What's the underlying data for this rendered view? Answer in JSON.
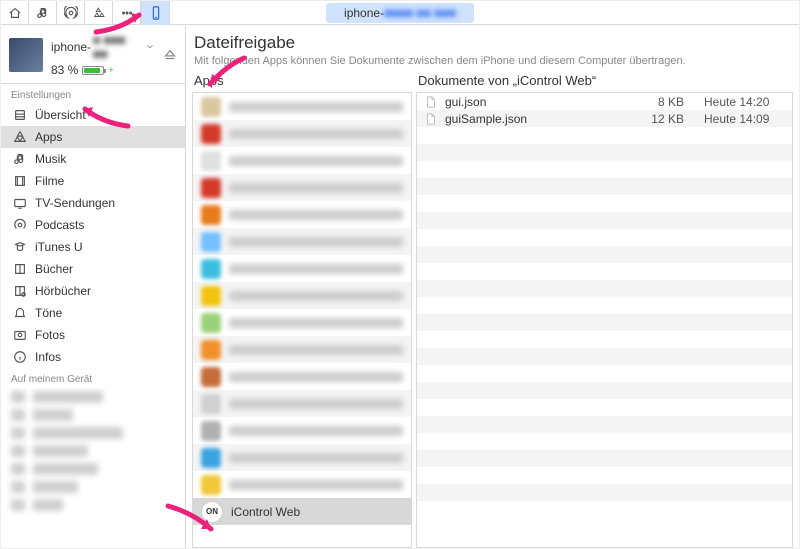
{
  "toolbar": {
    "title_prefix": "iphone-",
    "title_blur": "■■■■ ■■ ■■■"
  },
  "device": {
    "name_prefix": "iphone-",
    "name_blur": "■ ■■■ ■■",
    "battery_pct": "83 %"
  },
  "sidebar": {
    "section_settings": "Einstellungen",
    "section_on_device": "Auf meinem Gerät",
    "items": [
      {
        "label": "Übersicht",
        "icon": "settings-icon"
      },
      {
        "label": "Apps",
        "icon": "apps-icon",
        "selected": true
      },
      {
        "label": "Musik",
        "icon": "music-icon"
      },
      {
        "label": "Filme",
        "icon": "film-icon"
      },
      {
        "label": "TV-Sendungen",
        "icon": "tv-icon"
      },
      {
        "label": "Podcasts",
        "icon": "podcast-icon"
      },
      {
        "label": "iTunes U",
        "icon": "itunesu-icon"
      },
      {
        "label": "Bücher",
        "icon": "books-icon"
      },
      {
        "label": "Hörbücher",
        "icon": "audiobook-icon"
      },
      {
        "label": "Töne",
        "icon": "tones-icon"
      },
      {
        "label": "Fotos",
        "icon": "photos-icon"
      },
      {
        "label": "Infos",
        "icon": "info-icon"
      }
    ]
  },
  "filesharing": {
    "heading": "Dateifreigabe",
    "subtitle": "Mit folgenden Apps können Sie Dokumente zwischen dem iPhone und diesem Computer übertragen.",
    "apps_heading": "Apps",
    "docs_heading": "Dokumente von „iControl Web“",
    "apps": [
      {
        "color": "#d9c7a0"
      },
      {
        "color": "#d43a2a"
      },
      {
        "color": "#e0e0e0"
      },
      {
        "color": "#d43a2a"
      },
      {
        "color": "#e87b1c"
      },
      {
        "color": "#74c0ff"
      },
      {
        "color": "#3dbde0"
      },
      {
        "color": "#f2c40f"
      },
      {
        "color": "#9bd17a"
      },
      {
        "color": "#f08f2b"
      },
      {
        "color": "#c46d3a"
      },
      {
        "color": "#d0d0d0"
      },
      {
        "color": "#b0b0b0"
      },
      {
        "color": "#3aa3e0"
      },
      {
        "color": "#f0c838"
      }
    ],
    "selected_app": {
      "badge": "ON",
      "label": "iControl Web"
    },
    "documents": [
      {
        "name": "gui.json",
        "size": "8 KB",
        "date": "Heute 14:20"
      },
      {
        "name": "guiSample.json",
        "size": "12 KB",
        "date": "Heute 14:09"
      }
    ]
  }
}
